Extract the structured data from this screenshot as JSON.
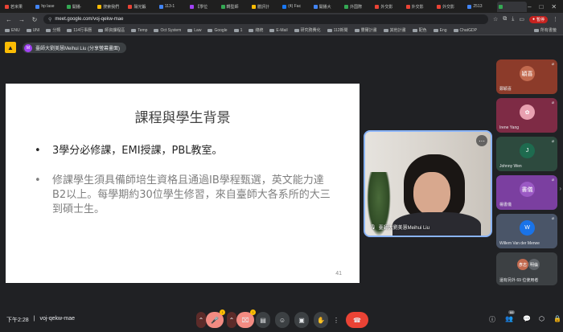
{
  "browser": {
    "tabs": [
      {
        "label": "若米果",
        "color": "#ea4335"
      },
      {
        "label": "hp lase",
        "color": "#4285f4"
      },
      {
        "label": "開播·",
        "color": "#34a853"
      },
      {
        "label": "搜索我們",
        "color": "#fbbc04"
      },
      {
        "label": "陽光鍛",
        "color": "#ea4335"
      },
      {
        "label": "113-1",
        "color": "#4285f4"
      },
      {
        "label": "【學位",
        "color": "#a142f4"
      },
      {
        "label": "轉型師",
        "color": "#34a853"
      },
      {
        "label": "體評計",
        "color": "#fbbc04"
      },
      {
        "label": "(4) Fac",
        "color": "#1877f2"
      },
      {
        "label": "開播大",
        "color": "#4285f4"
      },
      {
        "label": "外国際",
        "color": "#34a853"
      },
      {
        "label": "外交影",
        "color": "#ea4335"
      },
      {
        "label": "外交影",
        "color": "#ea4335"
      },
      {
        "label": "外交影",
        "color": "#ea4335"
      },
      {
        "label": "2513",
        "color": "#4285f4"
      },
      {
        "label": "",
        "color": "#34a853",
        "active": true
      }
    ],
    "url": "meet.google.com/voj-qekw-mae",
    "profile": "暫停",
    "bookmarks": [
      "ENU",
      "UNI",
      "分類",
      "114行事曆",
      "師資課程區",
      "Temp",
      "Oct System",
      "Law",
      "Google",
      "1",
      "總統",
      "E-Mail",
      "研究務費化",
      "112新聞",
      "豐爾計畫",
      "其他計畫",
      "配色",
      "Eng",
      "ChatGDP"
    ],
    "bookmarks_right": "所有書籤"
  },
  "meet": {
    "presenter_chip": "臺師大劉美慧Meihui Liu (分享螢幕畫面)",
    "presenter_initial": "M",
    "slide": {
      "title": "課程與學生背景",
      "bullets": [
        "3學分必修課，EMI授課，PBL教室。",
        "修課學生須具備師培生資格且通過IB學程甄選，英文能力達B2以上。每學期約30位學生修習，來自臺師大各系所的大三到碩士生。"
      ],
      "page": "41"
    },
    "speaker_name": "臺師大劉美慧Meihui Liu",
    "participants": [
      {
        "name": "鄭穎喜",
        "initial": "穎喜",
        "color": "#c26a4f"
      },
      {
        "name": "Irene Yang",
        "initial": "✿",
        "color": "#e8a0b0"
      },
      {
        "name": "Johnny Wen",
        "initial": "J",
        "color": "#1e6b4f"
      },
      {
        "name": "楊書儀",
        "initial": "書儀",
        "color": "#9b59c4"
      },
      {
        "name": "Willem Van der Merwe",
        "initial": "W",
        "color": "#1a73e8"
      }
    ],
    "others_tile": {
      "label": "還有另外 69 位使用者",
      "a": "彥志",
      "b": "明倫"
    },
    "time": "下午2:28",
    "meeting_code": "voj-qekw-mae",
    "participant_count": "66",
    "mic_badge": "!",
    "cam_badge": "!"
  }
}
